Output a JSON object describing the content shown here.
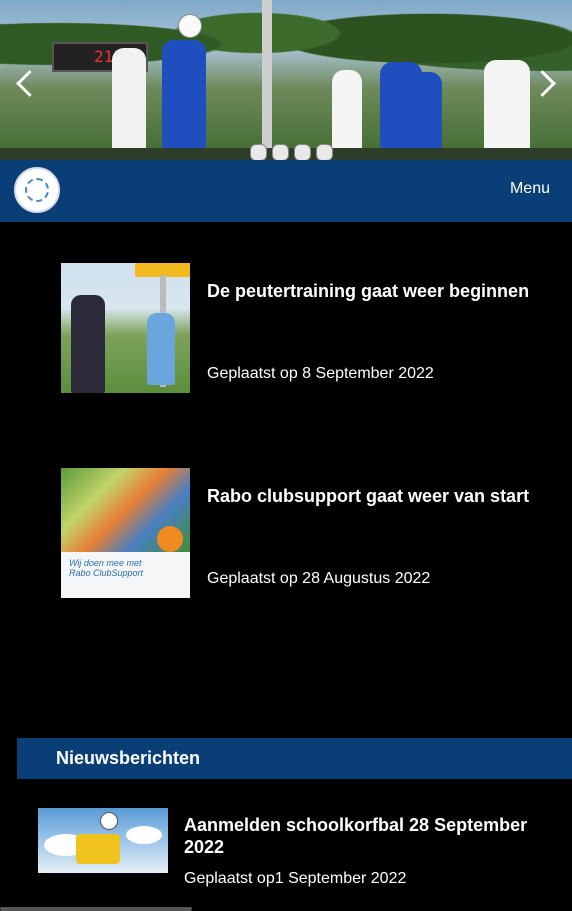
{
  "hero": {
    "scoreboard_label": "215",
    "slides": 4
  },
  "navbar": {
    "menu_label": "Menu"
  },
  "featured": [
    {
      "title": "De peutertraining gaat weer beginnen",
      "date": "Geplaatst op 8 September 2022"
    },
    {
      "title": "Rabo clubsupport gaat weer van start",
      "date": "Geplaatst op 28 Augustus 2022",
      "thumb_text1": "Wij doen mee met",
      "thumb_text2": "Rabo ClubSupport"
    }
  ],
  "news": {
    "header": "Nieuwsberichten",
    "items": [
      {
        "title": "Aanmelden schoolkorfbal 28 September 2022",
        "date": "Geplaatst op1 September 2022"
      }
    ]
  },
  "colors": {
    "nav": "#0a3e76",
    "background": "#000000"
  }
}
